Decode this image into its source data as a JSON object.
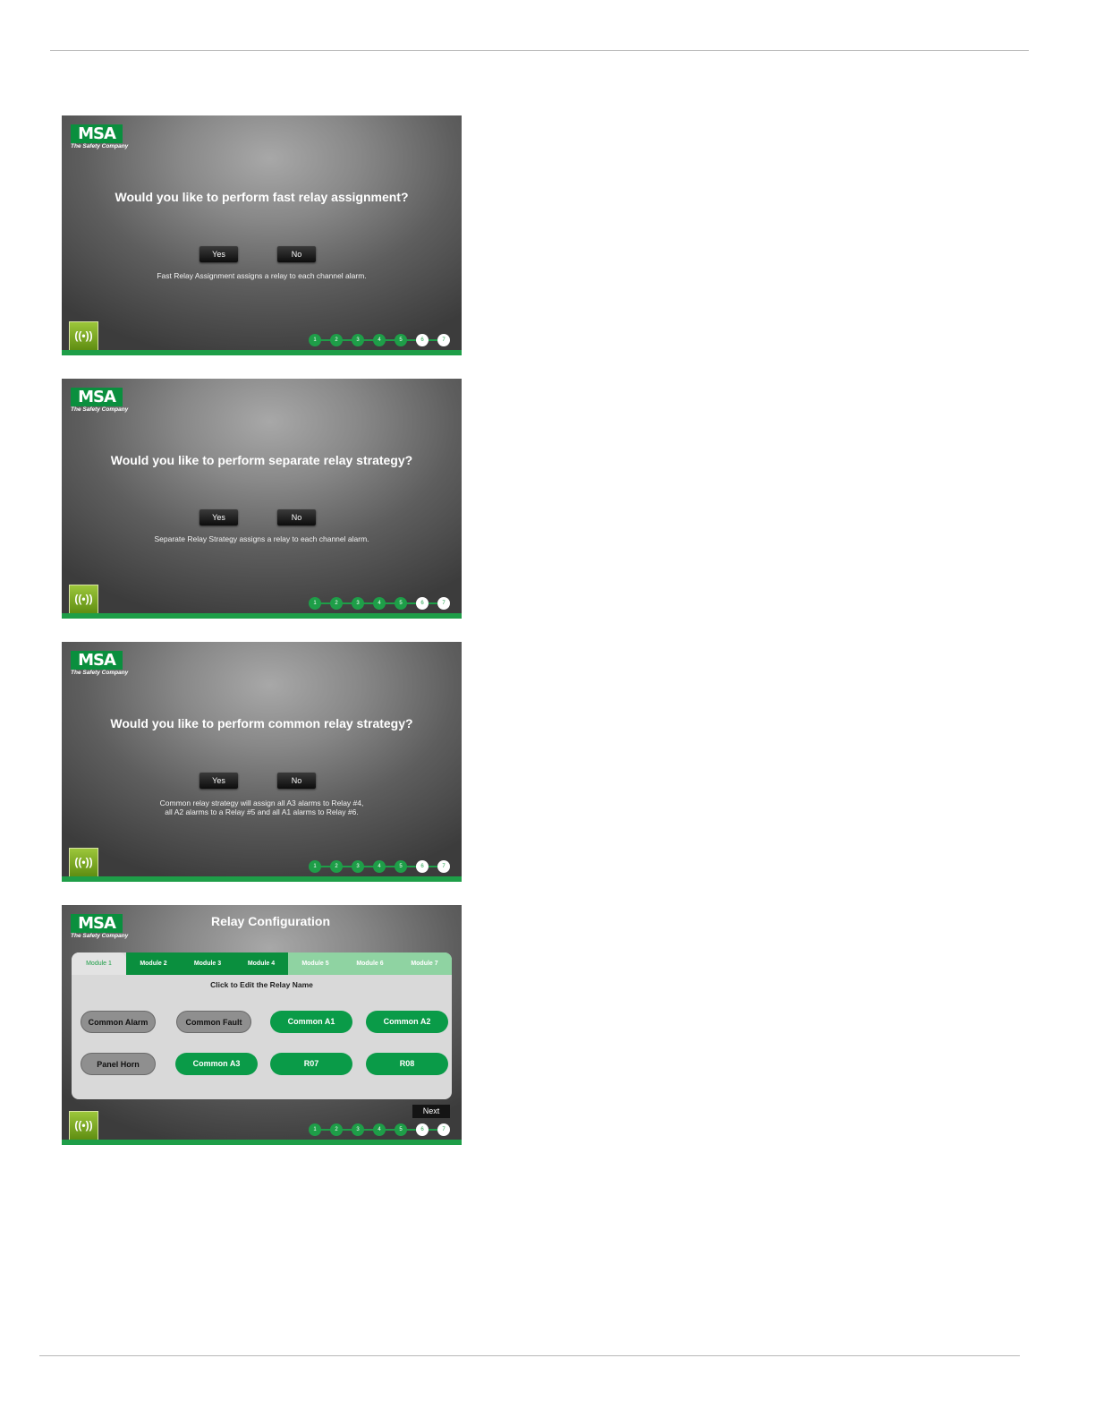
{
  "brand": {
    "logo_text": "MSA",
    "tagline": "The Safety Company"
  },
  "steps": [
    "1",
    "2",
    "3",
    "4",
    "5",
    "6",
    "7"
  ],
  "dialogs": [
    {
      "question": "Would you like to perform fast relay assignment?",
      "yes_label": "Yes",
      "no_label": "No",
      "description_lines": [
        "Fast Relay Assignment assigns a relay to each channel alarm."
      ]
    },
    {
      "question": "Would you like to perform separate relay strategy?",
      "yes_label": "Yes",
      "no_label": "No",
      "description_lines": [
        "Separate Relay Strategy assigns a relay to each channel alarm."
      ]
    },
    {
      "question": "Would you like to perform common relay strategy?",
      "yes_label": "Yes",
      "no_label": "No",
      "description_lines": [
        "Common relay strategy will assign all A3 alarms to Relay #4,",
        "all A2 alarms to a Relay #5 and all A1 alarms to Relay #6."
      ]
    }
  ],
  "relay_config": {
    "title": "Relay Configuration",
    "tabs": [
      "Module 1",
      "Module 2",
      "Module 3",
      "Module 4",
      "Module 5",
      "Module 6",
      "Module 7"
    ],
    "hint": "Click to Edit the Relay Name",
    "relays": [
      "Common Alarm",
      "Common Fault",
      "Common A1",
      "Common A2",
      "Panel Horn",
      "Common A3",
      "R07",
      "R08"
    ],
    "next_label": "Next"
  },
  "colors": {
    "brand_green": "#0a8f3e",
    "step_green": "#1e9e48",
    "inactive_tab": "#8fd3a2",
    "alarm_icon": "#7fae25"
  },
  "icons": {
    "alarm": "alarm-bell-icon"
  }
}
